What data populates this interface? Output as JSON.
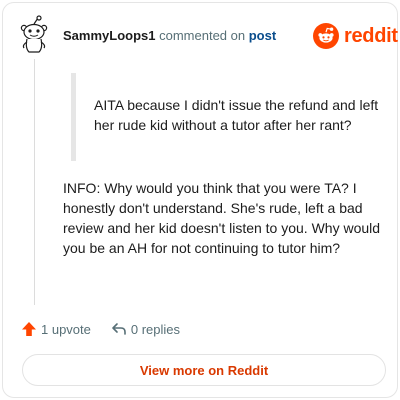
{
  "comment": {
    "username": "SammyLoops1",
    "action": "commented on",
    "target": "post",
    "quote": "AITA because I didn't issue the refund and left her rude kid without a tutor after her rant?",
    "body": "INFO: Why would you think that you were TA? I honestly don't understand. She's rude, left a bad review and her kid doesn't listen to you. Why would you be an AH for not continuing to tutor him?"
  },
  "brand": {
    "wordmark": "reddit",
    "color": "#ff4500"
  },
  "footer": {
    "upvotes": "1 upvote",
    "replies": "0 replies"
  },
  "cta": {
    "label": "View more on Reddit",
    "color": "#d93900"
  },
  "icons": {
    "avatar": "snoo-avatar-icon",
    "brand": "reddit-logo-icon",
    "upvote": "upvote-arrow-icon",
    "reply": "reply-arrow-icon"
  }
}
